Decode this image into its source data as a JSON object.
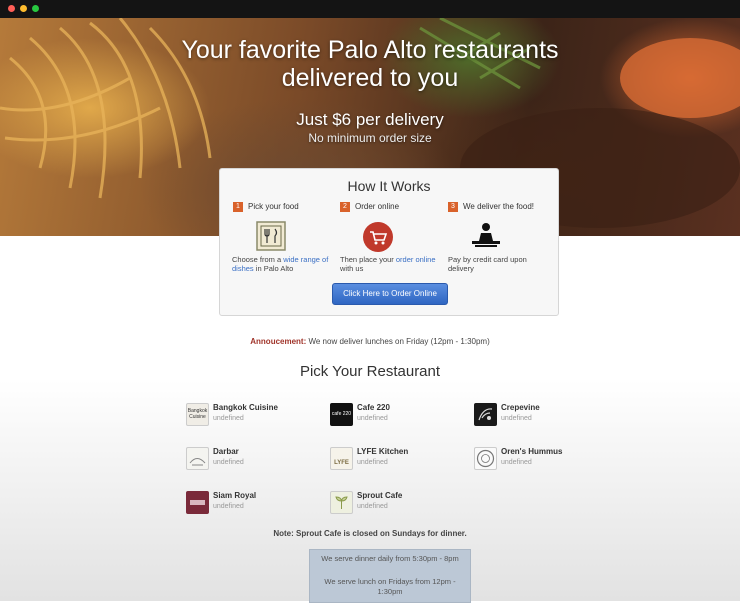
{
  "hero": {
    "title_line1": "Your favorite Palo Alto restaurants",
    "title_line2": "delivered to you",
    "delivery_price": "Just $6 per delivery",
    "minimum": "No minimum order size"
  },
  "how_it_works": {
    "title": "How It Works",
    "steps": [
      {
        "num": "1",
        "label": "Pick your food",
        "desc_pre": "Choose from a ",
        "desc_link": "wide range of dishes",
        "desc_post": " in Palo Alto",
        "icon": "fork-knife-plate-icon"
      },
      {
        "num": "2",
        "label": "Order online",
        "desc_pre": "Then place your ",
        "desc_link": "order online",
        "desc_post": " with us",
        "icon": "shopping-cart-icon"
      },
      {
        "num": "3",
        "label": "We deliver the food!",
        "desc_pre": "Pay by credit card upon delivery",
        "desc_link": "",
        "desc_post": "",
        "icon": "delivery-person-icon"
      }
    ],
    "button_label": "Click Here to Order Online"
  },
  "announcement": {
    "label": "Annoucement:",
    "text": " We now deliver lunches on Friday (12pm - 1:30pm)"
  },
  "pick": {
    "title": "Pick Your Restaurant",
    "restaurants": [
      {
        "name": "Bangkok Cuisine",
        "sub": "undefined",
        "logo_text": "Bangkok Cuisine"
      },
      {
        "name": "Cafe 220",
        "sub": "undefined",
        "logo_text": "cafe 220"
      },
      {
        "name": "Crepevine",
        "sub": "undefined",
        "logo_text": ""
      },
      {
        "name": "Darbar",
        "sub": "undefined",
        "logo_text": ""
      },
      {
        "name": "LYFE Kitchen",
        "sub": "undefined",
        "logo_text": "LYFE"
      },
      {
        "name": "Oren's Hummus",
        "sub": "undefined",
        "logo_text": ""
      },
      {
        "name": "Siam Royal",
        "sub": "undefined",
        "logo_text": ""
      },
      {
        "name": "Sprout Cafe",
        "sub": "undefined",
        "logo_text": ""
      }
    ]
  },
  "note": "Note: Sprout Cafe is closed on Sundays for dinner.",
  "hours": {
    "dinner": "We serve dinner daily from 5:30pm - 8pm",
    "lunch": "We serve lunch on Fridays from 12pm - 1:30pm"
  },
  "colors": {
    "accent_orange": "#d9622b",
    "button_blue": "#2f66c2",
    "link_blue": "#3a6fc4",
    "announce_red": "#a0342a"
  }
}
